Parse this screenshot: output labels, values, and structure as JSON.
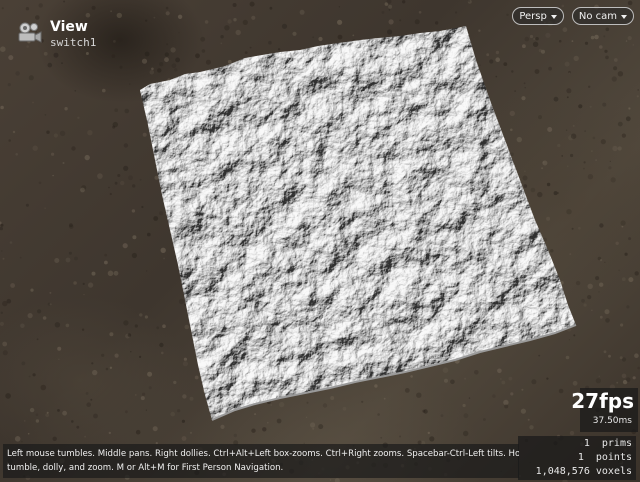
{
  "viewer": {
    "title": "View",
    "node_name": "switch1",
    "icon": "camera-icon"
  },
  "menus": {
    "projection": "Persp",
    "camera": "No cam"
  },
  "performance": {
    "fps": "27fps",
    "frame_time": "37.50ms"
  },
  "stats": {
    "prims": "1  prims",
    "points": "1  points",
    "voxels": "1,048,576 voxels"
  },
  "help": {
    "line1": "Left mouse tumbles. Middle pans. Right dollies. Ctrl+Alt+Left box-zooms. Ctrl+Right zooms. Spacebar-Ctrl-Left tilts. Hold L for alternate",
    "line2": "tumble, dolly, and zoom. M or Alt+M for First Person Navigation."
  },
  "colors": {
    "ground": "#3e362e",
    "terrain_light": "#e9e9e9",
    "terrain_shadow": "#8a8a8a",
    "overlay": "#1a1a1a"
  }
}
